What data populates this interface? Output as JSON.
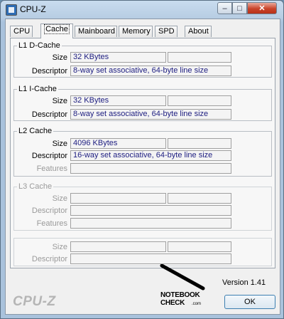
{
  "window": {
    "title": "CPU-Z",
    "close_glyph": "✕",
    "minimize_glyph": "–",
    "maximize_glyph": "□"
  },
  "tabs": [
    {
      "label": "CPU",
      "active": false
    },
    {
      "label": "Cache",
      "active": true
    },
    {
      "label": "Mainboard",
      "active": false
    },
    {
      "label": "Memory",
      "active": false
    },
    {
      "label": "SPD",
      "active": false
    },
    {
      "label": "About",
      "active": false
    }
  ],
  "l1d": {
    "legend": "L1 D-Cache",
    "size_label": "Size",
    "size_value": "32 KBytes",
    "size_extra": "",
    "descriptor_label": "Descriptor",
    "descriptor_value": "8-way set associative, 64-byte line size"
  },
  "l1i": {
    "legend": "L1 I-Cache",
    "size_label": "Size",
    "size_value": "32 KBytes",
    "size_extra": "",
    "descriptor_label": "Descriptor",
    "descriptor_value": "8-way set associative, 64-byte line size"
  },
  "l2": {
    "legend": "L2 Cache",
    "size_label": "Size",
    "size_value": "4096 KBytes",
    "size_extra": "",
    "descriptor_label": "Descriptor",
    "descriptor_value": "16-way set associative, 64-byte line size",
    "features_label": "Features",
    "features_value": ""
  },
  "l3": {
    "legend": "L3 Cache",
    "size_label": "Size",
    "size_value": "",
    "size_extra": "",
    "descriptor_label": "Descriptor",
    "descriptor_value": "",
    "features_label": "Features",
    "features_value": ""
  },
  "extra": {
    "size_label": "Size",
    "size_value": "",
    "size_extra": "",
    "descriptor_label": "Descriptor",
    "descriptor_value": ""
  },
  "footer": {
    "version": "Version 1.41",
    "brand": "CPU-Z",
    "ok_label": "OK"
  },
  "watermark": {
    "line1": "NOTEBOOK",
    "line2": "CHECK",
    "suffix": ".com"
  },
  "colors": {
    "value_text": "#1d1d80",
    "disabled_text": "#9a9a9a"
  },
  "icons": {
    "app": "cpu-z-app-icon"
  }
}
